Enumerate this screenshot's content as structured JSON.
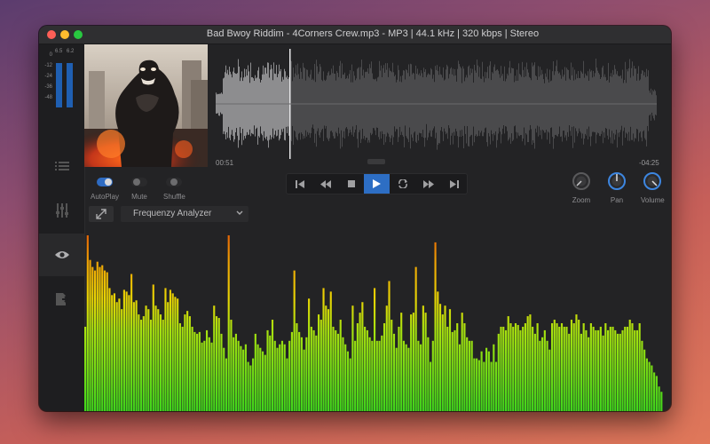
{
  "window": {
    "title": "Bad Bwoy Riddim - 4Corners Crew.mp3 - MP3 | 44.1 kHz | 320 kbps | Stereo"
  },
  "meter": {
    "left_top": "6.5",
    "right_top": "6.2",
    "scale": [
      "0",
      "-12",
      "-24",
      "-36",
      "-48"
    ],
    "left_level": 0.9,
    "right_level": 0.9,
    "color": "#1f5fb2"
  },
  "sidebar": {
    "items": [
      {
        "name": "playlist",
        "icon": "list-icon"
      },
      {
        "name": "mixer",
        "icon": "sliders-icon"
      },
      {
        "name": "visualizer",
        "icon": "eye-icon",
        "active": true
      },
      {
        "name": "export",
        "icon": "export-icon"
      }
    ]
  },
  "player": {
    "elapsed": "00:51",
    "remaining": "-04:25",
    "progress": 0.168
  },
  "toggles": [
    {
      "label": "AutoPlay",
      "on": true
    },
    {
      "label": "Mute",
      "on": false
    },
    {
      "label": "Shuffle",
      "on": false
    }
  ],
  "transport": {
    "buttons": [
      "skip-back-icon",
      "rewind-icon",
      "stop-icon",
      "play-icon",
      "repeat-icon",
      "fast-forward-icon",
      "skip-forward-icon"
    ],
    "accent": "#2d6ec4"
  },
  "knobs": [
    {
      "label": "Zoom",
      "color": "#9a9a9c"
    },
    {
      "label": "Pan",
      "color": "#3d86e0"
    },
    {
      "label": "Volume",
      "color": "#3d86e0"
    }
  ],
  "visualizer": {
    "mode": "Frequenzy Analyzer"
  },
  "spectrum": {
    "max": 100,
    "levels": [
      48,
      100,
      86,
      82,
      80,
      85,
      82,
      83,
      80,
      79,
      70,
      66,
      67,
      62,
      64,
      58,
      69,
      68,
      66,
      78,
      62,
      63,
      55,
      52,
      54,
      60,
      58,
      52,
      72,
      60,
      58,
      55,
      52,
      70,
      62,
      69,
      67,
      65,
      64,
      50,
      48,
      55,
      57,
      54,
      48,
      45,
      44,
      45,
      39,
      40,
      46,
      42,
      39,
      60,
      54,
      53,
      44,
      36,
      30,
      100,
      52,
      42,
      44,
      40,
      37,
      35,
      38,
      28,
      26,
      30,
      44,
      38,
      36,
      34,
      32,
      46,
      43,
      52,
      40,
      36,
      38,
      40,
      38,
      30,
      40,
      45,
      80,
      50,
      45,
      42,
      35,
      42,
      64,
      48,
      46,
      43,
      55,
      52,
      70,
      60,
      58,
      68,
      48,
      46,
      44,
      52,
      42,
      38,
      34,
      30,
      60,
      40,
      50,
      56,
      62,
      48,
      46,
      42,
      40,
      70,
      40,
      40,
      43,
      50,
      60,
      74,
      52,
      44,
      36,
      48,
      56,
      40,
      38,
      36,
      55,
      56,
      82,
      40,
      38,
      60,
      56,
      42,
      28,
      40,
      96,
      68,
      61,
      55,
      60,
      48,
      58,
      45,
      46,
      50,
      38,
      56,
      50,
      42,
      40,
      40,
      30,
      30,
      29,
      34,
      28,
      36,
      34,
      28,
      38,
      28,
      44,
      48,
      48,
      46,
      54,
      50,
      48,
      50,
      49,
      46,
      48,
      50,
      54,
      55,
      48,
      44,
      50,
      40,
      42,
      46,
      40,
      35,
      50,
      52,
      50,
      48,
      50,
      48,
      48,
      44,
      52,
      50,
      55,
      52,
      44,
      50,
      46,
      42,
      50,
      48,
      46,
      46,
      48,
      43,
      50,
      46,
      48,
      48,
      46,
      44,
      44,
      46,
      48,
      48,
      52,
      50,
      46,
      46,
      50,
      40,
      35,
      30,
      28,
      26,
      22,
      20,
      14,
      11
    ]
  }
}
